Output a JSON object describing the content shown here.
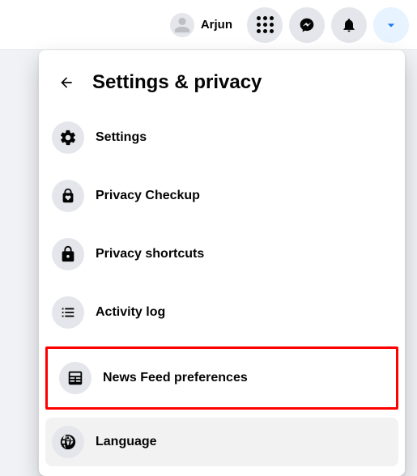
{
  "topbar": {
    "profile_name": "Arjun"
  },
  "dropdown": {
    "title": "Settings & privacy",
    "items": {
      "settings": "Settings",
      "privacy_checkup": "Privacy Checkup",
      "privacy_shortcuts": "Privacy shortcuts",
      "activity_log": "Activity log",
      "news_feed_preferences": "News Feed preferences",
      "language": "Language"
    }
  }
}
